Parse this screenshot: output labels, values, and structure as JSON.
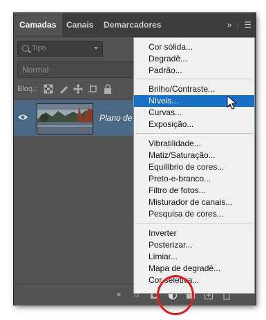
{
  "tabs": [
    {
      "label": "Camadas",
      "active": true
    },
    {
      "label": "Canais",
      "active": false
    },
    {
      "label": "Demarcadores",
      "active": false
    }
  ],
  "panel_controls": {
    "collapse_icon": "double-chevron-right",
    "menu_icon": "hamburger"
  },
  "filter": {
    "value": "Tipo",
    "icon": "search-icon"
  },
  "blend_mode": {
    "value": "Normal"
  },
  "lock": {
    "label": "Bloq.:",
    "icons": [
      "lock-transparency-icon",
      "lock-pixels-icon",
      "lock-position-icon",
      "artboard-icon",
      "lock-all-icon"
    ]
  },
  "layer": {
    "name": "Plano de",
    "visible": true
  },
  "footer_icons": [
    "link-icon",
    "fx-icon",
    "mask-icon",
    "adjustment-icon",
    "group-icon",
    "new-layer-icon",
    "trash-icon"
  ],
  "menu": {
    "group1": [
      "Cor sólida...",
      "Degradê...",
      "Padrão..."
    ],
    "group2": [
      "Brilho/Contraste...",
      "Níveis...",
      "Curvas...",
      "Exposição..."
    ],
    "group3": [
      "Vibratilidade...",
      "Matiz/Saturação...",
      "Equilíbrio de cores...",
      "Preto-e-branco...",
      "Filtro de fotos...",
      "Misturador de canais...",
      "Pesquisa de cores..."
    ],
    "group4": [
      "Inverter",
      "Posterizar...",
      "Limiar...",
      "Mapa de degradê...",
      "Cor seletiva..."
    ],
    "highlighted": "Níveis..."
  },
  "colors": {
    "panel": "#535353",
    "selected_layer": "#4a6784",
    "highlight": "#1a6fc6",
    "annotation": "#e51b1b"
  }
}
